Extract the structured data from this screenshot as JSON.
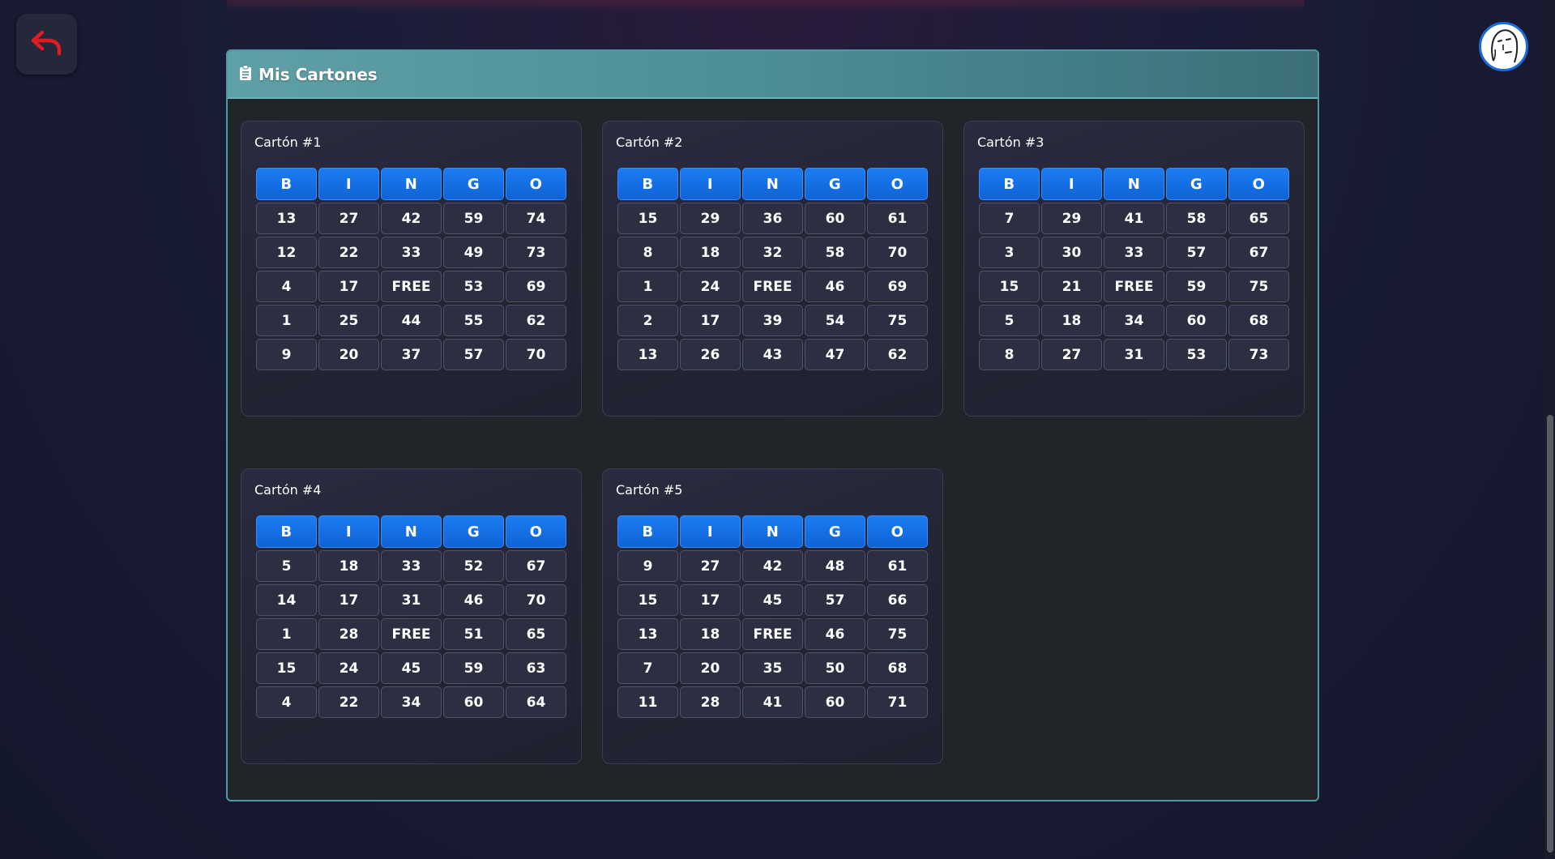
{
  "panel": {
    "title": "Mis Cartones"
  },
  "colors": {
    "header_accent": "#5fa0a6",
    "bingo_header": "#1b7cf2",
    "back_icon": "#e01b24"
  },
  "header_letters": [
    "B",
    "I",
    "N",
    "G",
    "O"
  ],
  "cards": [
    {
      "title": "Cartón #1",
      "rows": [
        [
          "13",
          "27",
          "42",
          "59",
          "74"
        ],
        [
          "12",
          "22",
          "33",
          "49",
          "73"
        ],
        [
          "4",
          "17",
          "FREE",
          "53",
          "69"
        ],
        [
          "1",
          "25",
          "44",
          "55",
          "62"
        ],
        [
          "9",
          "20",
          "37",
          "57",
          "70"
        ]
      ]
    },
    {
      "title": "Cartón #2",
      "rows": [
        [
          "15",
          "29",
          "36",
          "60",
          "61"
        ],
        [
          "8",
          "18",
          "32",
          "58",
          "70"
        ],
        [
          "1",
          "24",
          "FREE",
          "46",
          "69"
        ],
        [
          "2",
          "17",
          "39",
          "54",
          "75"
        ],
        [
          "13",
          "26",
          "43",
          "47",
          "62"
        ]
      ]
    },
    {
      "title": "Cartón #3",
      "rows": [
        [
          "7",
          "29",
          "41",
          "58",
          "65"
        ],
        [
          "3",
          "30",
          "33",
          "57",
          "67"
        ],
        [
          "15",
          "21",
          "FREE",
          "59",
          "75"
        ],
        [
          "5",
          "18",
          "34",
          "60",
          "68"
        ],
        [
          "8",
          "27",
          "31",
          "53",
          "73"
        ]
      ]
    },
    {
      "title": "Cartón #4",
      "rows": [
        [
          "5",
          "18",
          "33",
          "52",
          "67"
        ],
        [
          "14",
          "17",
          "31",
          "46",
          "70"
        ],
        [
          "1",
          "28",
          "FREE",
          "51",
          "65"
        ],
        [
          "15",
          "24",
          "45",
          "59",
          "63"
        ],
        [
          "4",
          "22",
          "34",
          "60",
          "64"
        ]
      ]
    },
    {
      "title": "Cartón #5",
      "rows": [
        [
          "9",
          "27",
          "42",
          "48",
          "61"
        ],
        [
          "15",
          "17",
          "45",
          "57",
          "66"
        ],
        [
          "13",
          "18",
          "FREE",
          "46",
          "75"
        ],
        [
          "7",
          "20",
          "35",
          "50",
          "68"
        ],
        [
          "11",
          "28",
          "41",
          "60",
          "71"
        ]
      ]
    }
  ]
}
